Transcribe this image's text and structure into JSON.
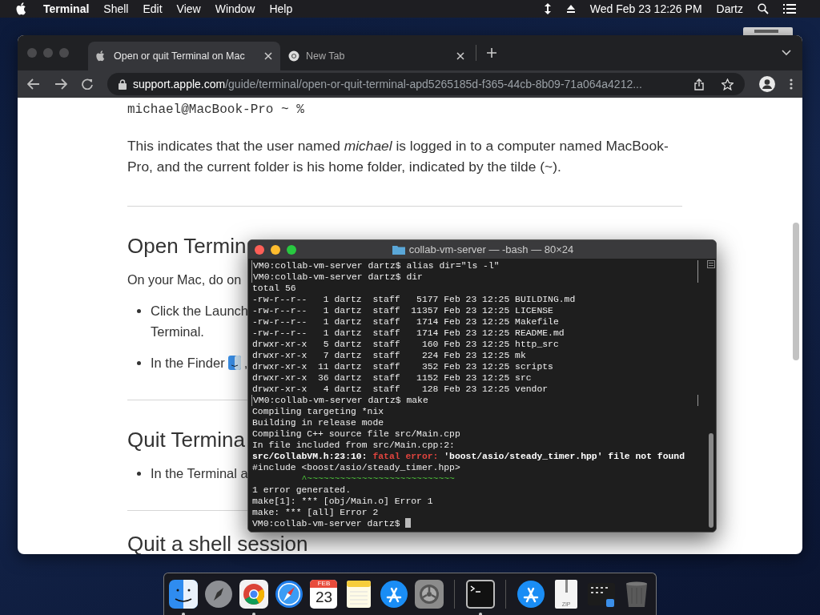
{
  "menu_bar": {
    "app": "Terminal",
    "items": [
      "Shell",
      "Edit",
      "View",
      "Window",
      "Help"
    ],
    "clock": "Wed Feb 23  12:26 PM",
    "user": "Dartz"
  },
  "browser": {
    "tabs": [
      {
        "title": "Open or quit Terminal on Mac",
        "selected": true
      },
      {
        "title": "New Tab",
        "selected": false
      }
    ],
    "address": {
      "host": "support.apple.com",
      "path": "/guide/terminal/open-or-quit-terminal-apd5265185d-f365-44cb-8b09-71a064a4212..."
    },
    "page": [
      {
        "kind": "code",
        "text": "michael@MacBook-Pro ~ %"
      },
      {
        "kind": "para",
        "text": "This indicates that the user named *michael* is logged in to a computer named MacBook-Pro, and the current folder is his home folder, indicated by the tilde (~)."
      },
      {
        "kind": "rule"
      },
      {
        "kind": "heading",
        "text": "Open Termin"
      },
      {
        "kind": "para",
        "text": "On your Mac, do on"
      },
      {
        "kind": "bullet",
        "text": "Click the Launch",
        "text2": "Terminal."
      },
      {
        "kind": "bullet_icon",
        "text": "In the Finder",
        "after": ","
      },
      {
        "kind": "rule"
      },
      {
        "kind": "heading",
        "text": "Quit Termina"
      },
      {
        "kind": "bullet",
        "text": "In the Terminal a"
      },
      {
        "kind": "rule"
      },
      {
        "kind": "heading",
        "text": "Quit a shell session"
      }
    ]
  },
  "terminal": {
    "title": "collab-vm-server — -bash — 80×24",
    "lines": [
      {
        "kind": "prompt",
        "text": "VM0:collab-vm-server dartz$ alias dir=\"ls -l\"",
        "marked": true,
        "cursor": false
      },
      {
        "kind": "prompt",
        "text": "VM0:collab-vm-server dartz$ dir",
        "marked": true,
        "cursor": false
      },
      {
        "kind": "plain",
        "text": "total 56"
      },
      {
        "kind": "plain",
        "text": "-rw-r--r--   1 dartz  staff   5177 Feb 23 12:25 BUILDING.md"
      },
      {
        "kind": "plain",
        "text": "-rw-r--r--   1 dartz  staff  11357 Feb 23 12:25 LICENSE"
      },
      {
        "kind": "plain",
        "text": "-rw-r--r--   1 dartz  staff   1714 Feb 23 12:25 Makefile"
      },
      {
        "kind": "plain",
        "text": "-rw-r--r--   1 dartz  staff   1714 Feb 23 12:25 README.md"
      },
      {
        "kind": "plain",
        "text": "drwxr-xr-x   5 dartz  staff    160 Feb 23 12:25 http_src"
      },
      {
        "kind": "plain",
        "text": "drwxr-xr-x   7 dartz  staff    224 Feb 23 12:25 mk"
      },
      {
        "kind": "plain",
        "text": "drwxr-xr-x  11 dartz  staff    352 Feb 23 12:25 scripts"
      },
      {
        "kind": "plain",
        "text": "drwxr-xr-x  36 dartz  staff   1152 Feb 23 12:25 src"
      },
      {
        "kind": "plain",
        "text": "drwxr-xr-x   4 dartz  staff    128 Feb 23 12:25 vendor"
      },
      {
        "kind": "prompt",
        "text": "VM0:collab-vm-server dartz$ make",
        "marked": true,
        "cursor": false
      },
      {
        "kind": "plain",
        "text": "Compiling targeting *nix"
      },
      {
        "kind": "plain",
        "text": "Building in release mode"
      },
      {
        "kind": "plain",
        "text": "Compiling C++ source file src/Main.cpp"
      },
      {
        "kind": "plain",
        "text": "In file included from src/Main.cpp:2:"
      },
      {
        "kind": "error",
        "segments": [
          {
            "kind": "location",
            "text": "src/CollabVM.h:23:10: "
          },
          {
            "kind": "severity",
            "text": "fatal error:"
          },
          {
            "kind": "message",
            "text": " 'boost/asio/steady_timer.hpp' file not found"
          }
        ]
      },
      {
        "kind": "plain",
        "text": "#include <boost/asio/steady_timer.hpp>"
      },
      {
        "kind": "marker",
        "text": "         ^~~~~~~~~~~~~~~~~~~~~~~~~~~~"
      },
      {
        "kind": "plain",
        "text": "1 error generated."
      },
      {
        "kind": "plain",
        "text": "make[1]: *** [obj/Main.o] Error 1"
      },
      {
        "kind": "plain",
        "text": "make: *** [all] Error 2"
      },
      {
        "kind": "prompt",
        "text": "VM0:collab-vm-server dartz$ ",
        "marked": false,
        "cursor": true
      }
    ]
  },
  "dock": [
    {
      "kind": "finder",
      "running": true
    },
    {
      "kind": "launchpad",
      "running": false
    },
    {
      "kind": "chrome",
      "running": true
    },
    {
      "kind": "safari",
      "running": false
    },
    {
      "kind": "calendar",
      "running": false,
      "month": "FEB",
      "day": "23"
    },
    {
      "kind": "notes",
      "running": false
    },
    {
      "kind": "appstore",
      "running": false
    },
    {
      "kind": "settings",
      "running": false
    },
    {
      "kind": "separator"
    },
    {
      "kind": "terminal",
      "running": true
    },
    {
      "kind": "separator"
    },
    {
      "kind": "downloads",
      "running": false
    },
    {
      "kind": "zip",
      "running": false,
      "label": "ZIP"
    },
    {
      "kind": "screenshot",
      "running": false
    },
    {
      "kind": "trash",
      "running": false
    }
  ]
}
